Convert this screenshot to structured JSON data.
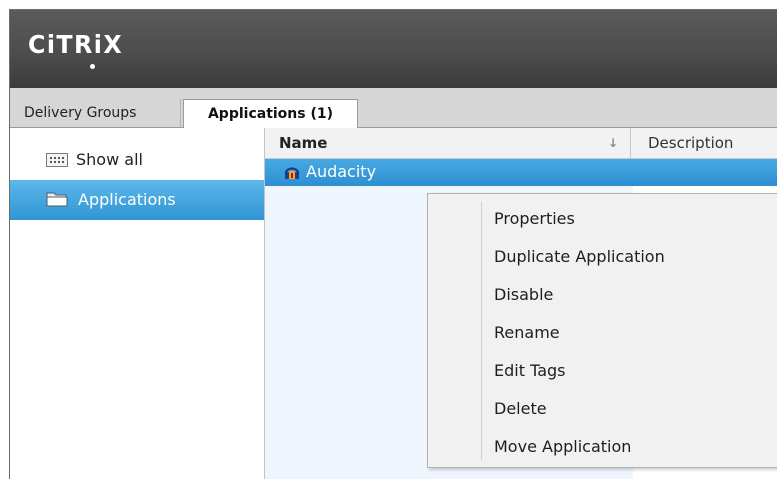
{
  "brand": {
    "logo_text": "CiTRiX"
  },
  "tabs": [
    {
      "label": "Delivery Groups",
      "active": false
    },
    {
      "label": "Applications (1)",
      "active": true
    }
  ],
  "sidebar": {
    "items": [
      {
        "label": "Show all",
        "icon": "grid-icon",
        "selected": false
      },
      {
        "label": "Applications",
        "icon": "folder-icon",
        "selected": true
      }
    ]
  },
  "table": {
    "columns": [
      {
        "label": "Name",
        "sort": "descending"
      },
      {
        "label": "Description"
      }
    ],
    "rows": [
      {
        "name": "Audacity",
        "icon": "audacity-app-icon",
        "selected": true
      }
    ]
  },
  "context_menu": {
    "items": [
      "Properties",
      "Duplicate Application",
      "Disable",
      "Rename",
      "Edit Tags",
      "Delete",
      "Move Application"
    ]
  },
  "colors": {
    "header": "#4d4d4d",
    "selection": "#2f95d4",
    "menu_background": "#f1f1f1"
  }
}
